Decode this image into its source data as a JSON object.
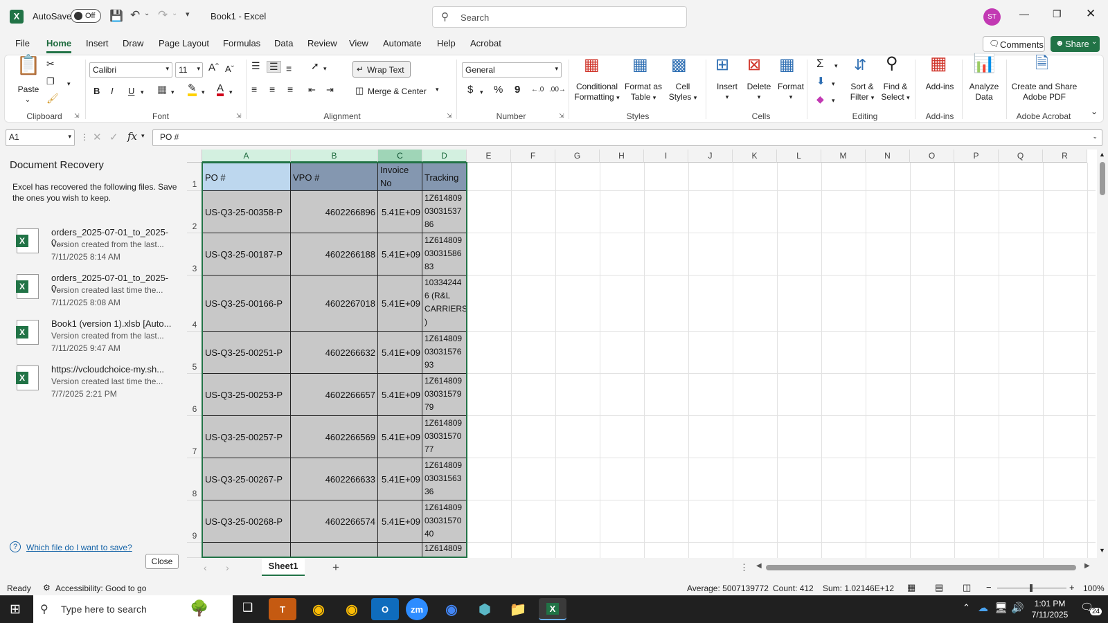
{
  "titlebar": {
    "autosave_label": "AutoSave",
    "autosave_state": "Off",
    "doc_title": "Book1  -  Excel",
    "search_placeholder": "Search",
    "avatar_initials": "ST"
  },
  "menu": {
    "tabs": [
      "File",
      "Home",
      "Insert",
      "Draw",
      "Page Layout",
      "Formulas",
      "Data",
      "Review",
      "View",
      "Automate",
      "Help",
      "Acrobat"
    ],
    "active": "Home",
    "comments_label": "Comments",
    "share_label": "Share"
  },
  "ribbon": {
    "clipboard": {
      "paste": "Paste",
      "label": "Clipboard"
    },
    "font": {
      "name": "Calibri",
      "size": "11",
      "bold": "B",
      "italic": "I",
      "underline": "U",
      "label": "Font"
    },
    "alignment": {
      "wrap_text": "Wrap Text",
      "merge_center": "Merge & Center",
      "label": "Alignment"
    },
    "number": {
      "format": "General",
      "currency": "$",
      "percent": "%",
      "comma": "9",
      "label": "Number"
    },
    "styles": {
      "conditional_1": "Conditional",
      "conditional_2": "Formatting",
      "format_table_1": "Format as",
      "format_table_2": "Table",
      "cell_styles_1": "Cell",
      "cell_styles_2": "Styles",
      "label": "Styles"
    },
    "cells": {
      "insert": "Insert",
      "delete": "Delete",
      "format": "Format",
      "label": "Cells"
    },
    "editing": {
      "sort_1": "Sort &",
      "sort_2": "Filter",
      "find_1": "Find &",
      "find_2": "Select",
      "sigma": "Σ",
      "label": "Editing"
    },
    "addins": {
      "addins": "Add-ins",
      "label": "Add-ins"
    },
    "analyze": {
      "line1": "Analyze",
      "line2": "Data"
    },
    "acrobat": {
      "line1": "Create and Share",
      "line2": "Adobe PDF",
      "label": "Adobe Acrobat"
    }
  },
  "formula_bar": {
    "name_box": "A1",
    "fx": "fx",
    "content": "PO #"
  },
  "recovery": {
    "title": "Document Recovery",
    "description": "Excel has recovered the following files.  Save the ones you wish to keep.",
    "files": [
      {
        "name": "orders_2025-07-01_to_2025-0...",
        "version": "Version created from the last...",
        "time": "7/11/2025 8:14 AM"
      },
      {
        "name": "orders_2025-07-01_to_2025-0...",
        "version": "Version created last time the...",
        "time": "7/11/2025 8:08 AM"
      },
      {
        "name": "Book1 (version 1).xlsb  [Auto...",
        "version": "Version created from the last...",
        "time": "7/11/2025 9:47 AM"
      },
      {
        "name": "https://vcloudchoice-my.sh...",
        "version": "Version created last time the...",
        "time": "7/7/2025 2:21 PM"
      }
    ],
    "help_link": "Which file do I want to save?",
    "close_label": "Close"
  },
  "sheet": {
    "columns": [
      "A",
      "B",
      "C",
      "D",
      "E",
      "F",
      "G",
      "H",
      "I",
      "J",
      "K",
      "L",
      "M",
      "N",
      "O",
      "P",
      "Q",
      "R"
    ],
    "headers": {
      "a": "PO #",
      "b": "VPO #",
      "c1": "Invoice",
      "c2": "No",
      "d": "Tracking"
    },
    "rows": [
      {
        "num": "2",
        "po": "US-Q3-25-00358-P",
        "vpo": "4602266896",
        "inv": "5.41E+09",
        "track": [
          "1Z614809",
          "03031537",
          "86"
        ]
      },
      {
        "num": "3",
        "po": "US-Q3-25-00187-P",
        "vpo": "4602266188",
        "inv": "5.41E+09",
        "track": [
          "1Z614809",
          "03031586",
          "83"
        ]
      },
      {
        "num": "4",
        "po": "US-Q3-25-00166-P",
        "vpo": "4602267018",
        "inv": "5.41E+09",
        "track": [
          "10334244",
          "6 (R&L",
          "CARRIERS",
          ")"
        ]
      },
      {
        "num": "5",
        "po": "US-Q3-25-00251-P",
        "vpo": "4602266632",
        "inv": "5.41E+09",
        "track": [
          "1Z614809",
          "03031576",
          "93"
        ]
      },
      {
        "num": "6",
        "po": "US-Q3-25-00253-P",
        "vpo": "4602266657",
        "inv": "5.41E+09",
        "track": [
          "1Z614809",
          "03031579",
          "79"
        ]
      },
      {
        "num": "7",
        "po": "US-Q3-25-00257-P",
        "vpo": "4602266569",
        "inv": "5.41E+09",
        "track": [
          "1Z614809",
          "03031570",
          "77"
        ]
      },
      {
        "num": "8",
        "po": "US-Q3-25-00267-P",
        "vpo": "4602266633",
        "inv": "5.41E+09",
        "track": [
          "1Z614809",
          "03031563",
          "36"
        ]
      },
      {
        "num": "9",
        "po": "US-Q3-25-00268-P",
        "vpo": "4602266574",
        "inv": "5.41E+09",
        "track": [
          "1Z614809",
          "03031570",
          "40"
        ]
      }
    ],
    "partial_row_track": "1Z614809",
    "row1": "1",
    "sheet_tab": "Sheet1",
    "add_sheet": "+"
  },
  "status": {
    "ready": "Ready",
    "accessibility": "Accessibility: Good to go",
    "average": "Average: 5007139772",
    "count": "Count: 412",
    "sum": "Sum: 1.02146E+12",
    "zoom": "100%"
  },
  "taskbar": {
    "search_placeholder": "Type here to search",
    "time": "1:01 PM",
    "date": "7/11/2025",
    "notif_count": "24"
  },
  "colors": {
    "accent": "#217346",
    "selection_fill": "#c8c8c8",
    "header_fill_a": "#bdd7ee",
    "header_fill_b": "#8497b0",
    "avatar": "#c239b3"
  }
}
